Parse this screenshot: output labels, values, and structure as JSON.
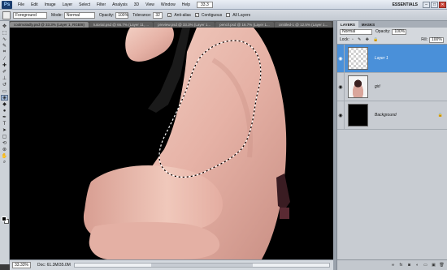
{
  "menubar": {
    "logo": "Ps",
    "items": [
      "File",
      "Edit",
      "Image",
      "Layer",
      "Select",
      "Filter",
      "Analysis",
      "3D",
      "View",
      "Window",
      "Help"
    ],
    "zoom": "33.3",
    "workspace": "ESSENTIALS",
    "window_buttons": [
      "–",
      "□",
      "✕"
    ]
  },
  "options": {
    "preset": "Foreground",
    "mode_label": "Mode:",
    "mode_value": "Normal",
    "opacity_label": "Opacity:",
    "opacity_value": "100%",
    "tolerance_label": "Tolerance:",
    "tolerance_value": "32",
    "antialias_label": "Anti-alias",
    "contiguous_label": "Contiguous",
    "alllayers_label": "All Layers"
  },
  "tabs": [
    "coolmoladly.psd @ 33.3% (Layer 1, RGB/8)",
    "tutorial.psd @ 66.7% (Layer 11, ...",
    "preview.psd @ 33.3% (Layer 1...",
    "pencil.psd @ 16.7% (Layer 1...",
    "Untitled-1 @ 12.5% (Layer 1..."
  ],
  "status": {
    "zoom": "33.33%",
    "doc": "Doc: 61.3M/35.0M"
  },
  "panel": {
    "tabs": [
      "LAYERS",
      "MASKS"
    ],
    "blend_mode": "Normal",
    "opacity_label": "Opacity:",
    "opacity_value": "100%",
    "lock_label": "Lock:",
    "fill_label": "Fill:",
    "fill_value": "100%",
    "layers": [
      {
        "name": "Layer 1",
        "thumb": "transparent",
        "active": true
      },
      {
        "name": "girl",
        "thumb": "girl",
        "active": false
      },
      {
        "name": "Background",
        "thumb": "black",
        "active": false,
        "locked": true
      }
    ]
  },
  "colors": {
    "selected_layer": "#4a90d9",
    "canvas_bg": "#000000"
  }
}
